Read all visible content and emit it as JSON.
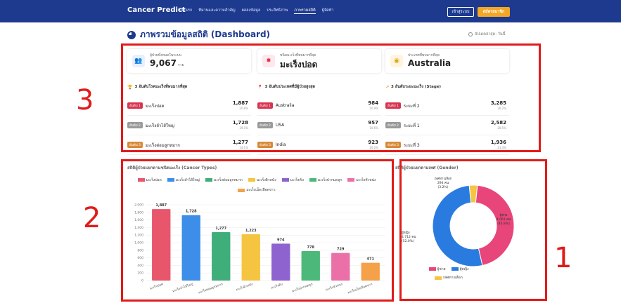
{
  "nav": {
    "brand": "Cancer Predict",
    "links": [
      "หน้าแรก",
      "ทีมานและความสำคัญ",
      "ผลลงข้อมูล",
      "ประสิทธิภาพ",
      "ภาพรวมสถิติ",
      "ผู้จัดทำ"
    ],
    "active_index": 4,
    "login_label": "เข้าสู่ระบบ",
    "register_label": "สมัครสมาชิก"
  },
  "header": {
    "title": "ภาพรวมข้อมูลสถิติ (Dashboard)",
    "updated": "อัปเดตล่าสุด: วันนี้"
  },
  "stats": [
    {
      "label": "ผู้ป่วยทั้งหมดในระบบ",
      "value": "9,067",
      "unit": "ราย",
      "icon": "users-icon",
      "color": "#3b6fd8",
      "bg": "#e8efff"
    },
    {
      "label": "ชนิดมะเร็งที่พบมากที่สุด",
      "value": "มะเร็งปอด",
      "unit": "",
      "icon": "virus-icon",
      "color": "#d8334f",
      "bg": "#fde8ec"
    },
    {
      "label": "ประเทศที่พบมากที่สุด",
      "value": "Australia",
      "unit": "",
      "icon": "globe-icon",
      "color": "#e0a419",
      "bg": "#fff5dc"
    }
  ],
  "rankings": [
    {
      "title": "3 อันดับโรคมะเร็งที่พบมากที่สุด",
      "icon": "trophy-icon",
      "rows": [
        {
          "badge": "อันดับ 1",
          "name": "มะเร็งปอด",
          "count": "1,887",
          "pct": "20.8%",
          "color": "#d8334f"
        },
        {
          "badge": "อันดับ 2",
          "name": "มะเร็งลำไส้ใหญ่",
          "count": "1,728",
          "pct": "19.1%",
          "color": "#9a9a9a"
        },
        {
          "badge": "อันดับ 3",
          "name": "มะเร็งต่อมลูกหมาก",
          "count": "1,277",
          "pct": "14.1%",
          "color": "#d88a3a"
        }
      ]
    },
    {
      "title": "3 อันดับประเทศที่มีผู้ป่วยสูงสุด",
      "icon": "map-pin-icon",
      "rows": [
        {
          "badge": "อันดับ 1",
          "name": "Australia",
          "count": "984",
          "pct": "10.9%",
          "color": "#d8334f"
        },
        {
          "badge": "อันดับ 2",
          "name": "USA",
          "count": "957",
          "pct": "10.6%",
          "color": "#9a9a9a"
        },
        {
          "badge": "อันดับ 3",
          "name": "India",
          "count": "923",
          "pct": "10.2%",
          "color": "#d88a3a"
        }
      ]
    },
    {
      "title": "3 อันดับระยะมะเร็ง (Stage)",
      "icon": "trend-icon",
      "rows": [
        {
          "badge": "อันดับ 1",
          "name": "ระยะที่ 2",
          "count": "3,285",
          "pct": "36.2%",
          "color": "#d8334f"
        },
        {
          "badge": "อันดับ 2",
          "name": "ระยะที่ 1",
          "count": "2,582",
          "pct": "28.5%",
          "color": "#9a9a9a"
        },
        {
          "badge": "อันดับ 3",
          "name": "ระยะที่ 3",
          "count": "1,936",
          "pct": "21.4%",
          "color": "#d88a3a"
        }
      ]
    }
  ],
  "annotations": [
    "1",
    "2",
    "3"
  ],
  "chart_data": [
    {
      "type": "bar",
      "title": "สถิติผู้ป่วยแยกตามชนิดมะเร็ง (Cancer Types)",
      "categories": [
        "มะเร็งปอด",
        "มะเร็งลำไส้ใหญ่",
        "มะเร็งต่อมลูกหมาก",
        "มะเร็งผิวหนัง",
        "มะเร็งตับ",
        "มะเร็งปากมดลูก",
        "มะเร็งหัวหน่ง",
        "มะเร็งเม็ดเลือดขาว"
      ],
      "values": [
        1887,
        1728,
        1277,
        1223,
        974,
        778,
        729,
        471
      ],
      "value_labels": [
        "1,887",
        "1,728",
        "1,277",
        "1,223",
        "974",
        "778",
        "729",
        "471"
      ],
      "colors": [
        "#e8566c",
        "#3d8ee8",
        "#3fae7a",
        "#f5c542",
        "#8e63cf",
        "#4cb87a",
        "#ec70a8",
        "#f5a149"
      ],
      "legend": [
        "มะเร็งปอด",
        "มะเร็งลำไส้ใหญ่",
        "มะเร็งต่อมลูกหมาก",
        "มะเร็งผิวหนัง",
        "มะเร็งตับ",
        "มะเร็งปากมดลูก",
        "มะเร็งหัวหน่ง",
        "มะเร็งเม็ดเลือดขาว"
      ],
      "yticks": [
        "2,000",
        "1,800",
        "1,600",
        "1,400",
        "1,200",
        "1,000",
        "800",
        "600",
        "400",
        "200",
        "0"
      ],
      "ylim": [
        0,
        2000
      ],
      "grid": true,
      "legend_position": "top"
    },
    {
      "type": "pie",
      "title": "สถิติผู้ป่วยแยกตามเพศ (Gender)",
      "labels": [
        "ผู้ชาย",
        "ผู้หญิง",
        "เพศทางเลือก"
      ],
      "values": [
        4061,
        4712,
        294
      ],
      "value_labels": [
        "4,061 คน",
        "4,712 คน",
        "294 คน"
      ],
      "pct_labels": [
        "(44.8%)",
        "(52.0%)",
        "(3.2%)"
      ],
      "colors": [
        "#e8457a",
        "#2a7be0",
        "#f5c542"
      ],
      "legend_position": "bottom"
    }
  ]
}
